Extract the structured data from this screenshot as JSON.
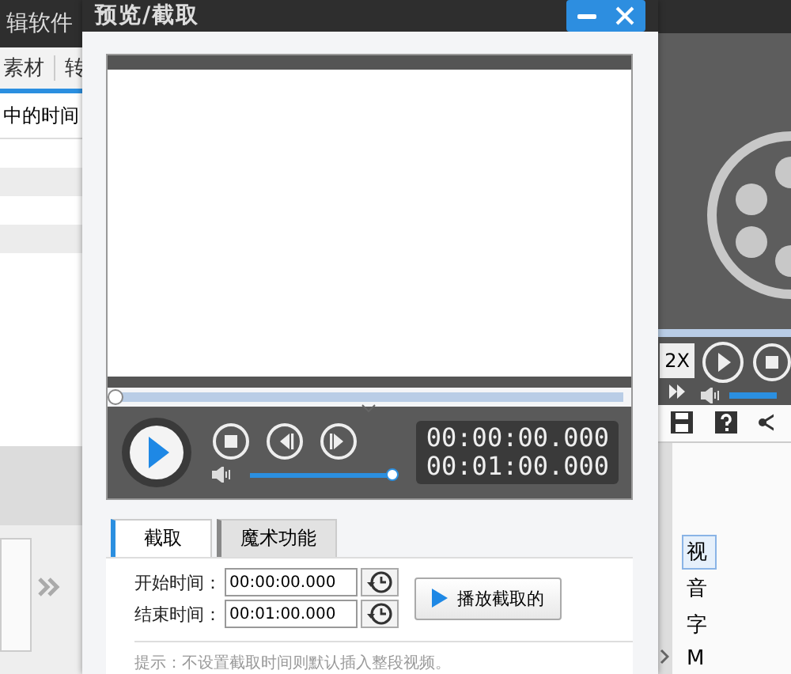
{
  "app": {
    "title": "辑软件",
    "toolbar": [
      "素材",
      "转"
    ],
    "column_header": "中的时间",
    "speed_button": "2X",
    "list_items": [
      {
        "label": "视",
        "selected": true
      },
      {
        "label": "音",
        "selected": false
      },
      {
        "label": "字",
        "selected": false
      },
      {
        "label": "M",
        "selected": false
      }
    ]
  },
  "dialog": {
    "title": "预览/截取",
    "progress": {
      "level": 0
    },
    "volume": {
      "level": 1
    },
    "times": [
      "00:00:00.000",
      "00:01:00.000"
    ],
    "tabs": [
      {
        "label": "截取",
        "selected": true
      },
      {
        "label": "魔术功能",
        "selected": false
      }
    ],
    "fields": [
      {
        "label": "开始时间：",
        "value": "00:00:00.000"
      },
      {
        "label": "结束时间：",
        "value": "00:01:00.000"
      }
    ],
    "play_clip_button": "播放截取的",
    "hint": "提示：不设置截取时间则默认插入整段视频。"
  }
}
